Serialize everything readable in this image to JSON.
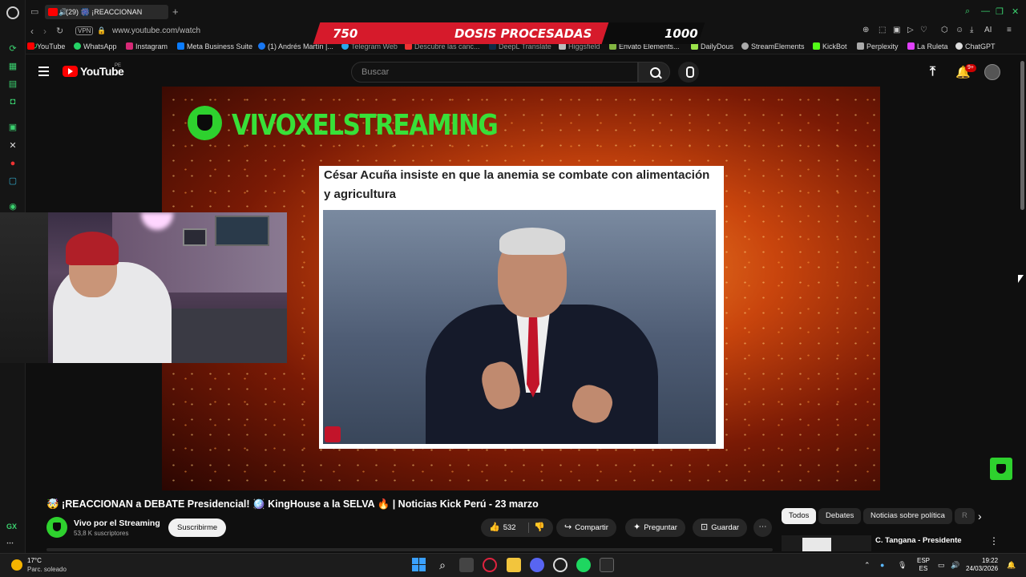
{
  "browser": {
    "tab": {
      "label": "(29) 🎆 ¡REACCIONAN"
    },
    "url": "www.youtube.com/watch",
    "vpn_label": "VPN",
    "bookmarks": [
      "YouTube",
      "WhatsApp",
      "Instagram",
      "Meta Business Suite",
      "(1) Andrés Martín |...",
      "Telegram Web",
      "Descubre las canc...",
      "DeepL Translate",
      "Higgsfield",
      "Envato Elements...",
      "DailyDous",
      "StreamElements",
      "KickBot",
      "Perplexity",
      "La Ruleta",
      "ChatGPT"
    ],
    "ai_label": "AI",
    "gx_label": "GX"
  },
  "overlay_banner": {
    "left_number": "750",
    "title": "DOSIS PROCESADAS",
    "right_number": "1000",
    "accent_color": "#d61a2b"
  },
  "youtube_header": {
    "logo_text": "YouTube",
    "region": "PE",
    "search_placeholder": "Buscar",
    "notifications_badge": "9+"
  },
  "player": {
    "brand_text": "VIVOXELSTREAMING",
    "news_headline": "César Acuña insiste en que la anemia se combate con alimentación y agricultura"
  },
  "video": {
    "title": "🤯 ¡REACCIONAN a DEBATE Presidencial! 🪩 KingHouse a la SELVA 🔥 | Noticias Kick Perú - 23 marzo",
    "channel_name": "Vivo por el Streaming",
    "subscribers": "53,8 K suscriptores",
    "subscribe_label": "Suscribirme",
    "likes": "532",
    "share_label": "Compartir",
    "ask_label": "Preguntar",
    "save_label": "Guardar"
  },
  "sidebar": {
    "chips": [
      "Todos",
      "Debates",
      "Noticias sobre política",
      "R"
    ],
    "recommendation_title": "C. Tangana - Presidente"
  },
  "taskbar": {
    "temperature": "17°C",
    "weather": "Parc. soleado",
    "lang_top": "ESP",
    "lang_bottom": "ES",
    "time": "19:22",
    "date": "24/03/2026"
  }
}
